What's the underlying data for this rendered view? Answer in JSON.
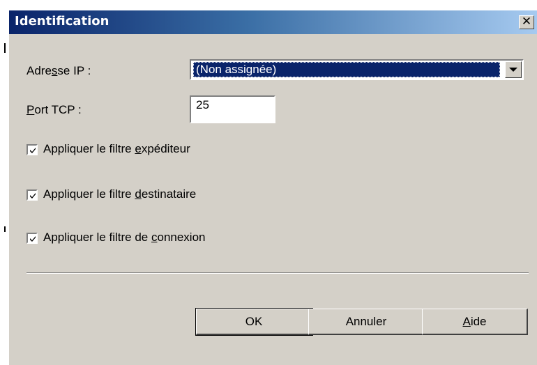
{
  "window": {
    "title": "Identification",
    "close_glyph": "✕"
  },
  "form": {
    "ip": {
      "label_pre": "Adre",
      "label_accel": "s",
      "label_post": "se IP :",
      "value": "(Non assignée)"
    },
    "port": {
      "label_accel": "P",
      "label_post": "ort TCP :",
      "value": "25"
    },
    "checkboxes": [
      {
        "pre": "Appliquer le filtre ",
        "accel": "e",
        "post": "xpéditeur",
        "checked": true
      },
      {
        "pre": "Appliquer le filtre ",
        "accel": "d",
        "post": "estinataire",
        "checked": true
      },
      {
        "pre": "Appliquer le filtre de ",
        "accel": "c",
        "post": "onnexion",
        "checked": true
      }
    ]
  },
  "buttons": {
    "ok": "OK",
    "cancel": "Annuler",
    "help_accel": "A",
    "help_post": "ide"
  },
  "colors": {
    "face": "#d4d0c8",
    "title_start": "#0a246a",
    "title_end": "#a6caf0",
    "selection": "#0a246a"
  }
}
